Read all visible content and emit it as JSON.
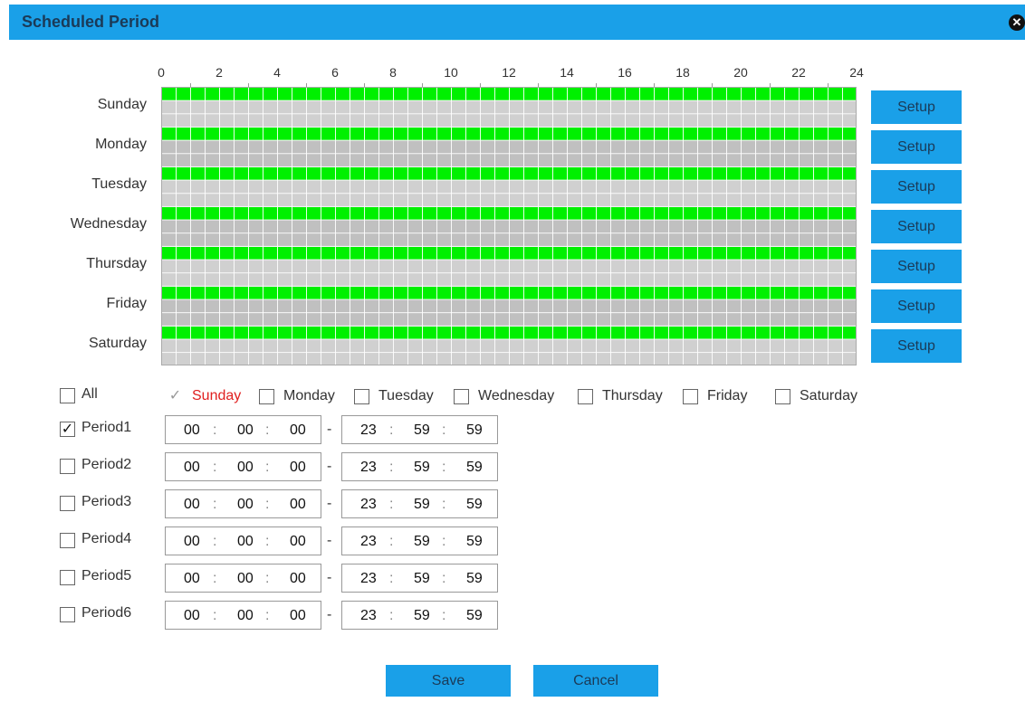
{
  "dialog": {
    "title": "Scheduled Period",
    "close_icon": "close-icon"
  },
  "hours": [
    "0",
    "2",
    "4",
    "6",
    "8",
    "10",
    "12",
    "14",
    "16",
    "18",
    "20",
    "22",
    "24"
  ],
  "days": [
    {
      "label": "Sunday",
      "setup": "Setup",
      "schedule": [
        [
          0,
          24
        ]
      ]
    },
    {
      "label": "Monday",
      "setup": "Setup",
      "schedule": [
        [
          0,
          24
        ]
      ]
    },
    {
      "label": "Tuesday",
      "setup": "Setup",
      "schedule": [
        [
          0,
          24
        ]
      ]
    },
    {
      "label": "Wednesday",
      "setup": "Setup",
      "schedule": [
        [
          0,
          24
        ]
      ]
    },
    {
      "label": "Thursday",
      "setup": "Setup",
      "schedule": [
        [
          0,
          24
        ]
      ]
    },
    {
      "label": "Friday",
      "setup": "Setup",
      "schedule": [
        [
          0,
          24
        ]
      ]
    },
    {
      "label": "Saturday",
      "setup": "Setup",
      "schedule": [
        [
          0,
          24
        ]
      ]
    }
  ],
  "colors": {
    "accent": "#1aa0e8",
    "schedule_bar": "#00f000",
    "selected_day": "#e02020"
  },
  "all_checkbox": {
    "label": "All",
    "checked": false
  },
  "day_checkboxes": [
    {
      "label": "Sunday",
      "checked": true,
      "disabled": true
    },
    {
      "label": "Monday",
      "checked": false
    },
    {
      "label": "Tuesday",
      "checked": false
    },
    {
      "label": "Wednesday",
      "checked": false
    },
    {
      "label": "Thursday",
      "checked": false
    },
    {
      "label": "Friday",
      "checked": false
    },
    {
      "label": "Saturday",
      "checked": false
    }
  ],
  "periods": [
    {
      "label": "Period1",
      "checked": true,
      "start": [
        "00",
        "00",
        "00"
      ],
      "end": [
        "23",
        "59",
        "59"
      ]
    },
    {
      "label": "Period2",
      "checked": false,
      "start": [
        "00",
        "00",
        "00"
      ],
      "end": [
        "23",
        "59",
        "59"
      ]
    },
    {
      "label": "Period3",
      "checked": false,
      "start": [
        "00",
        "00",
        "00"
      ],
      "end": [
        "23",
        "59",
        "59"
      ]
    },
    {
      "label": "Period4",
      "checked": false,
      "start": [
        "00",
        "00",
        "00"
      ],
      "end": [
        "23",
        "59",
        "59"
      ]
    },
    {
      "label": "Period5",
      "checked": false,
      "start": [
        "00",
        "00",
        "00"
      ],
      "end": [
        "23",
        "59",
        "59"
      ]
    },
    {
      "label": "Period6",
      "checked": false,
      "start": [
        "00",
        "00",
        "00"
      ],
      "end": [
        "23",
        "59",
        "59"
      ]
    }
  ],
  "time_separator": ":",
  "range_separator": "-",
  "footer": {
    "save_label": "Save",
    "cancel_label": "Cancel"
  }
}
